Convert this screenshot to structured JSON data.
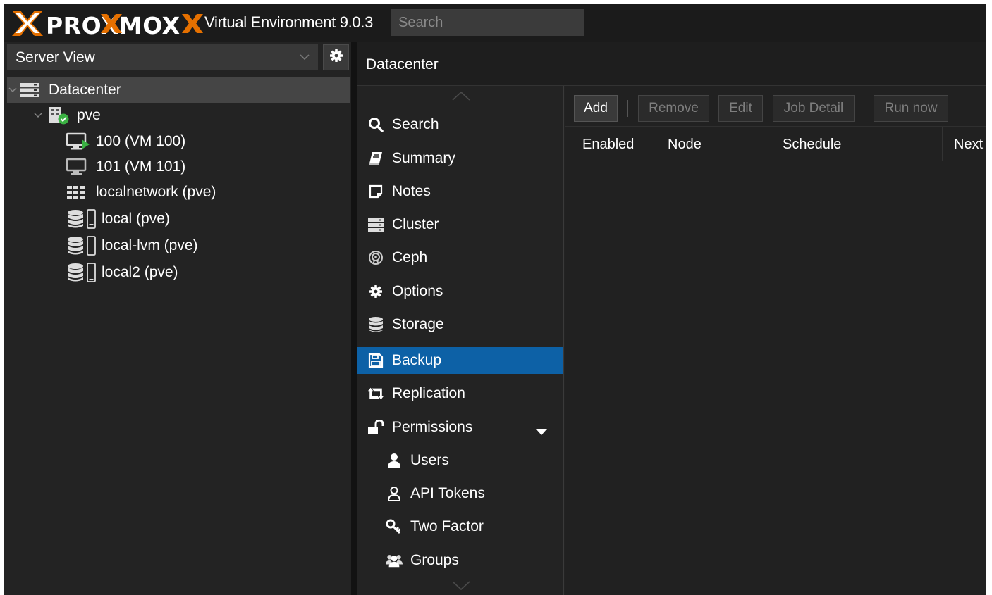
{
  "header": {
    "brand": "PROXMOX",
    "product": "Virtual Environment 9.0.3",
    "search_placeholder": "Search"
  },
  "tree_panel": {
    "view_label": "Server View",
    "nodes": [
      {
        "label": "Datacenter",
        "icon": "server-icon",
        "selected": true
      },
      {
        "label": "pve",
        "icon": "node-online-icon"
      },
      {
        "label": "100 (VM 100)",
        "icon": "vm-running-icon"
      },
      {
        "label": "101 (VM 101)",
        "icon": "vm-stopped-icon"
      },
      {
        "label": "localnetwork (pve)",
        "icon": "sdn-grid-icon"
      },
      {
        "label": "local (pve)",
        "icon": "storage-icon"
      },
      {
        "label": "local-lvm (pve)",
        "icon": "storage-icon"
      },
      {
        "label": "local2 (pve)",
        "icon": "storage-icon"
      }
    ]
  },
  "breadcrumb": "Datacenter",
  "nav": {
    "items": [
      {
        "label": "Search",
        "icon": "search-icon"
      },
      {
        "label": "Summary",
        "icon": "book-icon"
      },
      {
        "label": "Notes",
        "icon": "note-icon"
      },
      {
        "label": "Cluster",
        "icon": "server-icon"
      },
      {
        "label": "Ceph",
        "icon": "ceph-icon"
      },
      {
        "label": "Options",
        "icon": "gear-icon"
      },
      {
        "label": "Storage",
        "icon": "database-icon"
      },
      {
        "label": "Backup",
        "icon": "floppy-icon",
        "active": true
      },
      {
        "label": "Replication",
        "icon": "retweet-icon"
      },
      {
        "label": "Permissions",
        "icon": "unlock-icon",
        "expanded": true
      },
      {
        "label": "Users",
        "icon": "user-icon"
      },
      {
        "label": "API Tokens",
        "icon": "user-outline-icon"
      },
      {
        "label": "Two Factor",
        "icon": "key-icon"
      },
      {
        "label": "Groups",
        "icon": "users-icon"
      }
    ]
  },
  "toolbar": {
    "add": "Add",
    "remove": "Remove",
    "edit": "Edit",
    "job_detail": "Job Detail",
    "run_now": "Run now"
  },
  "grid": {
    "columns": [
      "Enabled",
      "Node",
      "Schedule",
      "Next"
    ]
  },
  "colors": {
    "accent": "#0d61a6",
    "brand_orange": "#e57000",
    "running_green": "#3bb143"
  }
}
